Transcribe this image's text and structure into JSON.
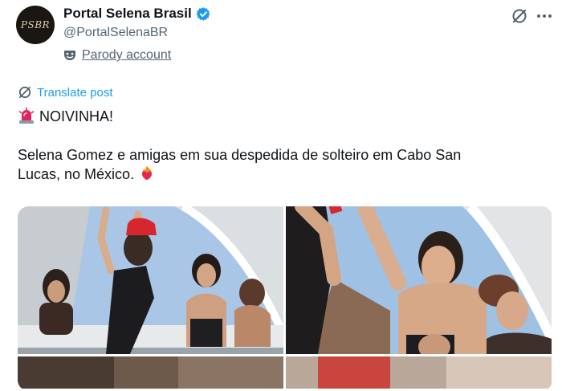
{
  "author": {
    "display_name": "Portal Selena Brasil",
    "handle": "@PortalSelenaBR",
    "avatar_text": "PSBR",
    "verified": true,
    "parody_label": "Parody account"
  },
  "translate": {
    "label": "Translate post"
  },
  "post": {
    "line1": "NOIVINHA!",
    "line2": "Selena Gomez e amigas em sua despedida de solteiro em Cabo San",
    "line3": "Lucas, no México."
  },
  "icons": {
    "alert": "rotating-light-icon",
    "emoji_end": "heart-on-fire-icon",
    "grok": "grok-icon",
    "more": "more-icon",
    "translate": "globe-icon",
    "verified": "verified-badge-icon",
    "parody": "theater-mask-icon"
  },
  "colors": {
    "link_blue": "#1d9bf0",
    "muted": "#536471",
    "text": "#0f1419"
  }
}
